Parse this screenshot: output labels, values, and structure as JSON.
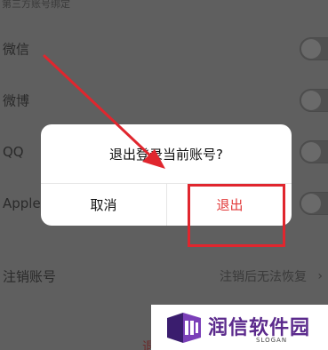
{
  "settings": {
    "section_header": "第三方账号绑定",
    "bindings": [
      {
        "label": "微信",
        "enabled": false
      },
      {
        "label": "微博",
        "enabled": false
      },
      {
        "label": "QQ",
        "enabled": false
      },
      {
        "label": "Apple",
        "enabled": false
      }
    ],
    "cancel_account": {
      "label": "注销账号",
      "value": "注销后无法恢复",
      "chevron": "›"
    },
    "logout_label": "退出"
  },
  "dialog": {
    "message": "退出登录当前账号?",
    "cancel_label": "取消",
    "confirm_label": "退出"
  },
  "colors": {
    "confirm": "#e23b3b",
    "annotation": "#e0262e",
    "brand": "#5b2a8c"
  },
  "watermark": {
    "title": "润信软件园",
    "slogan": "SLOGAN"
  }
}
